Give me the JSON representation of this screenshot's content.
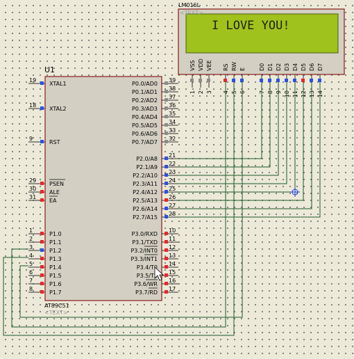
{
  "mcu": {
    "ref": "U1",
    "part": "AT89C51",
    "text_placeholder": "<TEXT>",
    "left_pins": [
      {
        "num": "19",
        "label": "XTAL1"
      },
      {
        "num": "18",
        "label": "XTAL2"
      },
      {
        "num": "9",
        "label": "RST"
      },
      {
        "num": "29",
        "label": "PSEN"
      },
      {
        "num": "30",
        "label": "ALE"
      },
      {
        "num": "31",
        "label": "EA"
      },
      {
        "num": "1",
        "label": "P1.0"
      },
      {
        "num": "2",
        "label": "P1.1"
      },
      {
        "num": "3",
        "label": "P1.2"
      },
      {
        "num": "4",
        "label": "P1.3"
      },
      {
        "num": "5",
        "label": "P1.4"
      },
      {
        "num": "6",
        "label": "P1.5"
      },
      {
        "num": "7",
        "label": "P1.6"
      },
      {
        "num": "8",
        "label": "P1.7"
      }
    ],
    "port0_pins": [
      {
        "num": "39",
        "label": "P0.0/AD0"
      },
      {
        "num": "38",
        "label": "P0.1/AD1"
      },
      {
        "num": "37",
        "label": "P0.2/AD2"
      },
      {
        "num": "36",
        "label": "P0.3/AD3"
      },
      {
        "num": "35",
        "label": "P0.4/AD4"
      },
      {
        "num": "34",
        "label": "P0.5/AD5"
      },
      {
        "num": "33",
        "label": "P0.6/AD6"
      },
      {
        "num": "32",
        "label": "P0.7/AD7"
      }
    ],
    "port2_pins": [
      {
        "num": "21",
        "label": "P2.0/A8"
      },
      {
        "num": "22",
        "label": "P2.1/A9"
      },
      {
        "num": "23",
        "label": "P2.2/A10"
      },
      {
        "num": "24",
        "label": "P2.3/A11"
      },
      {
        "num": "25",
        "label": "P2.4/A12"
      },
      {
        "num": "26",
        "label": "P2.5/A13"
      },
      {
        "num": "27",
        "label": "P2.6/A14"
      },
      {
        "num": "28",
        "label": "P2.7/A15"
      }
    ],
    "port3_pins": [
      {
        "num": "10",
        "label": "P3.0/RXD"
      },
      {
        "num": "11",
        "label": "P3.1/TXD"
      },
      {
        "num": "12",
        "label": "P3.2/INT0"
      },
      {
        "num": "13",
        "label": "P3.3/INT1"
      },
      {
        "num": "14",
        "label": "P3.4/T0"
      },
      {
        "num": "15",
        "label": "P3.5/T1"
      },
      {
        "num": "16",
        "label": "P3.6/WR"
      },
      {
        "num": "17",
        "label": "P3.7/RD"
      }
    ]
  },
  "lcd": {
    "ref": "LM016L",
    "text_placeholder": "<TEXT>",
    "display_text": "I LOVE YOU!",
    "pins": [
      {
        "num": "1",
        "label": "VSS"
      },
      {
        "num": "2",
        "label": "VDD"
      },
      {
        "num": "3",
        "label": "VEE"
      },
      {
        "num": "4",
        "label": "RS"
      },
      {
        "num": "5",
        "label": "RW"
      },
      {
        "num": "6",
        "label": "E"
      },
      {
        "num": "7",
        "label": "D0"
      },
      {
        "num": "8",
        "label": "D1"
      },
      {
        "num": "9",
        "label": "D2"
      },
      {
        "num": "10",
        "label": "D3"
      },
      {
        "num": "11",
        "label": "D4"
      },
      {
        "num": "12",
        "label": "D5"
      },
      {
        "num": "13",
        "label": "D6"
      },
      {
        "num": "14",
        "label": "D7"
      }
    ]
  },
  "colors": {
    "component_border": "#8b1a1a",
    "component_fill": "#d3d0c3",
    "wire": "#1c5a2c",
    "lcd_screen": "#9fc21d",
    "pin_high": "#e8262d",
    "pin_low": "#2a52e0",
    "pin_neutral": "#8c8c8c",
    "probe": "#1e3fd8"
  }
}
